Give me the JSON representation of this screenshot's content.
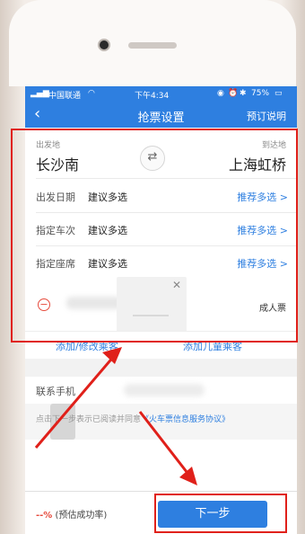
{
  "status_bar": {
    "carrier": "中国联通",
    "time": "下午4:34",
    "battery": "75%"
  },
  "navbar": {
    "back_icon": "‹",
    "title": "抢票设置",
    "right_action": "预订说明"
  },
  "route": {
    "from_label": "出发地",
    "from_city": "长沙南",
    "to_label": "到达地",
    "to_city": "上海虹桥",
    "swap_icon": "⇄"
  },
  "options": [
    {
      "label": "出发日期",
      "value": "建议多选",
      "action": "推荐多选",
      "chevron": ">"
    },
    {
      "label": "指定车次",
      "value": "建议多选",
      "action": "推荐多选",
      "chevron": ">"
    },
    {
      "label": "指定座席",
      "value": "建议多选",
      "action": "推荐多选",
      "chevron": ">"
    }
  ],
  "passenger": {
    "remove_icon": "−",
    "type": "成人票",
    "popup_close": "✕"
  },
  "passenger_actions": {
    "add_edit": "添加/修改乘客",
    "add_child": "添加儿童乘客"
  },
  "contact": {
    "label": "联系手机"
  },
  "agreement": {
    "prefix": "点击下一步表示已阅读并同意",
    "link": "《火车票信息服务协议》"
  },
  "footer": {
    "rate_value": "--%",
    "rate_label": "(预估成功率)",
    "next_button": "下一步"
  },
  "colors": {
    "primary": "#2e7fe0",
    "annotation_red": "#e0201a"
  }
}
